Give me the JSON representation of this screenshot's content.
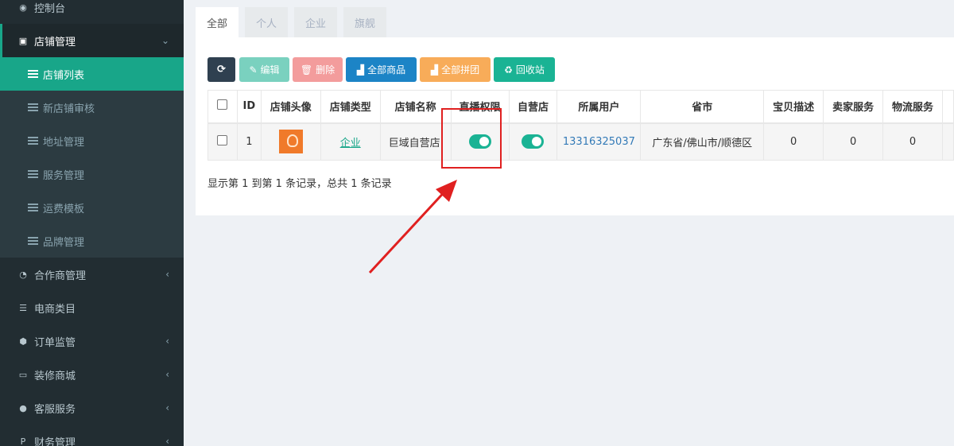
{
  "sidebar": {
    "items": [
      {
        "label": "控制台",
        "icon": "dashboard-icon"
      },
      {
        "label": "店铺管理",
        "icon": "store-icon"
      },
      {
        "label": "合作商管理",
        "icon": "partner-icon"
      },
      {
        "label": "电商类目",
        "icon": "category-icon"
      },
      {
        "label": "订单监管",
        "icon": "order-icon"
      },
      {
        "label": "装修商城",
        "icon": "monitor-icon"
      },
      {
        "label": "客服服务",
        "icon": "chat-icon"
      },
      {
        "label": "财务管理",
        "icon": "paypal-icon"
      }
    ],
    "sub_items": [
      {
        "label": "店铺列表"
      },
      {
        "label": "新店铺审核"
      },
      {
        "label": "地址管理"
      },
      {
        "label": "服务管理"
      },
      {
        "label": "运费模板"
      },
      {
        "label": "品牌管理"
      }
    ]
  },
  "tabs": [
    {
      "label": "全部"
    },
    {
      "label": "个人"
    },
    {
      "label": "企业"
    },
    {
      "label": "旗舰"
    }
  ],
  "toolbar": {
    "refresh_icon": "refresh-icon",
    "edit": "编辑",
    "delete": "删除",
    "all_goods": "全部商品",
    "all_group": "全部拼团",
    "recycle": "回收站"
  },
  "table": {
    "headers": [
      "ID",
      "店铺头像",
      "店铺类型",
      "店铺名称",
      "直播权限",
      "自营店",
      "所属用户",
      "省市",
      "宝贝描述",
      "卖家服务",
      "物流服务"
    ],
    "rows": [
      {
        "id": "1",
        "type": "企业",
        "name": "巨域自营店",
        "live_permission": true,
        "self_operated": true,
        "user": "13316325037",
        "region": "广东省/佛山市/顺德区",
        "desc_score": "0",
        "seller_score": "0",
        "logistics_score": "0"
      }
    ]
  },
  "pagination_text": "显示第 1 到第 1 条记录，总共 1 条记录",
  "colors": {
    "sidebar_bg": "#222d32",
    "accent": "#18a689",
    "annotation": "#e02020"
  }
}
